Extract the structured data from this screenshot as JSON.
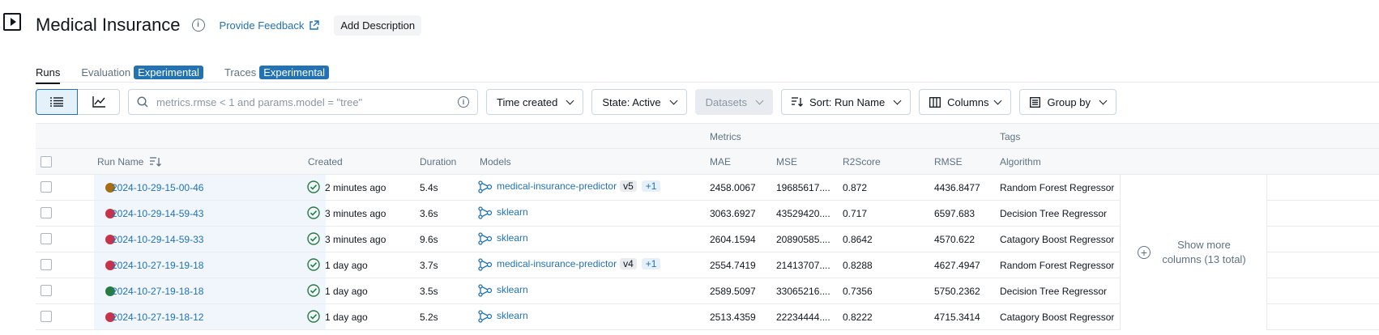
{
  "header": {
    "title": "Medical Insurance",
    "feedback_label": "Provide Feedback",
    "add_description_label": "Add Description"
  },
  "tabs": [
    {
      "label": "Runs",
      "badge": ""
    },
    {
      "label": "Evaluation",
      "badge": "Experimental"
    },
    {
      "label": "Traces",
      "badge": "Experimental"
    }
  ],
  "toolbar": {
    "search_placeholder": "metrics.rmse < 1 and params.model = \"tree\"",
    "time_created": "Time created",
    "state": "State: Active",
    "datasets": "Datasets",
    "sort": "Sort: Run Name",
    "columns": "Columns",
    "group_by": "Group by"
  },
  "table": {
    "groups": {
      "metrics": "Metrics",
      "tags": "Tags"
    },
    "columns": {
      "run_name": "Run Name",
      "created": "Created",
      "duration": "Duration",
      "models": "Models",
      "mae": "MAE",
      "mse": "MSE",
      "r2score": "R2Score",
      "rmse": "RMSE",
      "algorithm": "Algorithm"
    },
    "rows": [
      {
        "color": "#a86c12",
        "run_name": "2024-10-29-15-00-46",
        "created": "2 minutes ago",
        "duration": "5.4s",
        "model": "medical-insurance-predictor",
        "version": "v5",
        "extra": "+1",
        "mae": "2458.0067",
        "mse": "19685617....",
        "r2": "0.872",
        "rmse": "4436.8477",
        "algorithm": "Random Forest Regressor"
      },
      {
        "color": "#c8334a",
        "run_name": "2024-10-29-14-59-43",
        "created": "3 minutes ago",
        "duration": "3.6s",
        "model": "sklearn",
        "version": "",
        "extra": "",
        "mae": "3063.6927",
        "mse": "43529420....",
        "r2": "0.717",
        "rmse": "6597.683",
        "algorithm": "Decision Tree Regressor"
      },
      {
        "color": "#c8334a",
        "run_name": "2024-10-29-14-59-33",
        "created": "3 minutes ago",
        "duration": "9.6s",
        "model": "sklearn",
        "version": "",
        "extra": "",
        "mae": "2604.1594",
        "mse": "20890585....",
        "r2": "0.8642",
        "rmse": "4570.622",
        "algorithm": "Catagory Boost Regressor"
      },
      {
        "color": "#c8334a",
        "run_name": "2024-10-27-19-19-18",
        "created": "1 day ago",
        "duration": "3.7s",
        "model": "medical-insurance-predictor",
        "version": "v4",
        "extra": "+1",
        "mae": "2554.7419",
        "mse": "21413707....",
        "r2": "0.8288",
        "rmse": "4627.4947",
        "algorithm": "Random Forest Regressor"
      },
      {
        "color": "#277c43",
        "run_name": "2024-10-27-19-18-18",
        "created": "1 day ago",
        "duration": "3.5s",
        "model": "sklearn",
        "version": "",
        "extra": "",
        "mae": "2589.5097",
        "mse": "33065216....",
        "r2": "0.7356",
        "rmse": "5750.2362",
        "algorithm": "Decision Tree Regressor"
      },
      {
        "color": "#c8334a",
        "run_name": "2024-10-27-19-18-12",
        "created": "1 day ago",
        "duration": "5.2s",
        "model": "sklearn",
        "version": "",
        "extra": "",
        "mae": "2513.4359",
        "mse": "22234444....",
        "r2": "0.8222",
        "rmse": "4715.3414",
        "algorithm": "Catagory Boost Regressor"
      }
    ],
    "show_more": "Show more columns (13 total)"
  },
  "colors": {
    "accent": "#2272b4",
    "success": "#277c43"
  }
}
